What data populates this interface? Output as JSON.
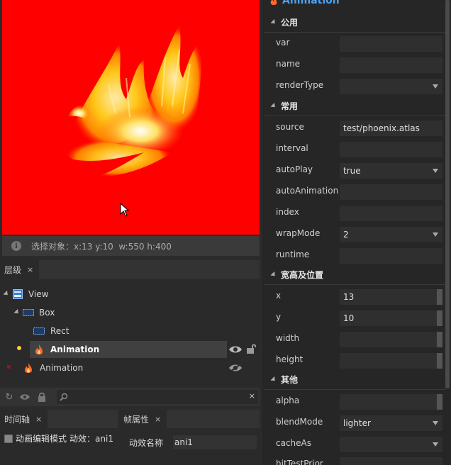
{
  "preview": {
    "status_text": "选择对象：x:13 y:10  w:550 h:400"
  },
  "layers_panel": {
    "tab_label": "层级",
    "tab_close": "×",
    "nodes": [
      {
        "label": "View"
      },
      {
        "label": "Box"
      },
      {
        "label": "Rect"
      },
      {
        "label": "Animation"
      },
      {
        "label": "Animation"
      }
    ],
    "search_clear": "×"
  },
  "timeline_panel": {
    "tab_label": "时间轴",
    "tab_close": "×",
    "mode_label": "动画编辑模式",
    "effect_label": "动效：",
    "effect_value": "ani1"
  },
  "frame_props_panel": {
    "tab_label": "帧属性",
    "tab_close": "×",
    "name_label": "动效名称",
    "name_value": "ani1"
  },
  "inspector": {
    "title": "Animation",
    "sections": [
      {
        "name": "公用",
        "props": [
          {
            "label": "var",
            "value": ""
          },
          {
            "label": "name",
            "value": ""
          },
          {
            "label": "renderType",
            "value": ""
          }
        ]
      },
      {
        "name": "常用",
        "props": [
          {
            "label": "source",
            "value": "test/phoenix.atlas"
          },
          {
            "label": "interval",
            "value": ""
          },
          {
            "label": "autoPlay",
            "value": "true"
          },
          {
            "label": "autoAnimation",
            "value": ""
          },
          {
            "label": "index",
            "value": ""
          },
          {
            "label": "wrapMode",
            "value": "2"
          },
          {
            "label": "runtime",
            "value": ""
          }
        ]
      },
      {
        "name": "宽高及位置",
        "props": [
          {
            "label": "x",
            "value": "13"
          },
          {
            "label": "y",
            "value": "10"
          },
          {
            "label": "width",
            "value": ""
          },
          {
            "label": "height",
            "value": ""
          }
        ]
      },
      {
        "name": "其他",
        "props": [
          {
            "label": "alpha",
            "value": ""
          },
          {
            "label": "blendMode",
            "value": "lighter"
          },
          {
            "label": "cacheAs",
            "value": ""
          },
          {
            "label": "hitTestPrior",
            "value": ""
          }
        ]
      }
    ]
  },
  "colors": {
    "stage_background": "#ff0000",
    "accent_title": "#4aa3f0",
    "selected_row": "#404040"
  }
}
